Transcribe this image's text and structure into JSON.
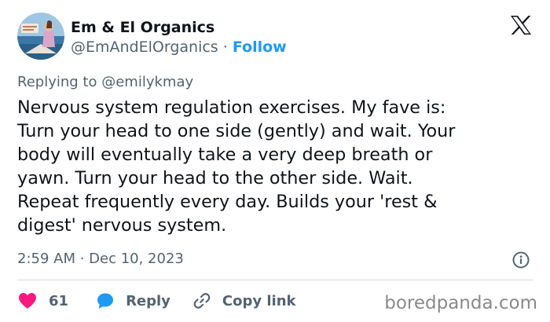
{
  "author": {
    "display_name": "Em & El Organics",
    "handle": "@EmAndElOrganics",
    "separator": "·",
    "follow_label": "Follow",
    "avatar_icon": "profile-photo-beach-scene"
  },
  "reply": {
    "prefix": "Replying to",
    "mention": "@emilykmay"
  },
  "tweet": {
    "text": "Nervous system regulation exercises. My fave is:\nTurn your head to one side (gently) and wait. Your\nbody will eventually take a very deep breath or\nyawn. Turn your head to the other side. Wait.\nRepeat frequently every day. Builds your 'rest &\ndigest' nervous system.",
    "timestamp": "2:59 AM · Dec 10, 2023"
  },
  "actions": {
    "like_count": "61",
    "reply_label": "Reply",
    "copy_link_label": "Copy link"
  },
  "icons": {
    "platform": "x-logo-icon",
    "info": "info-icon",
    "like": "heart-icon",
    "reply": "reply-bubble-icon",
    "link": "link-icon"
  },
  "colors": {
    "text_primary": "#0f1419",
    "text_secondary": "#536471",
    "accent": "#1d9bf0",
    "like": "#f91880",
    "divider": "#cfd9de"
  },
  "watermark": "boredpanda.com"
}
